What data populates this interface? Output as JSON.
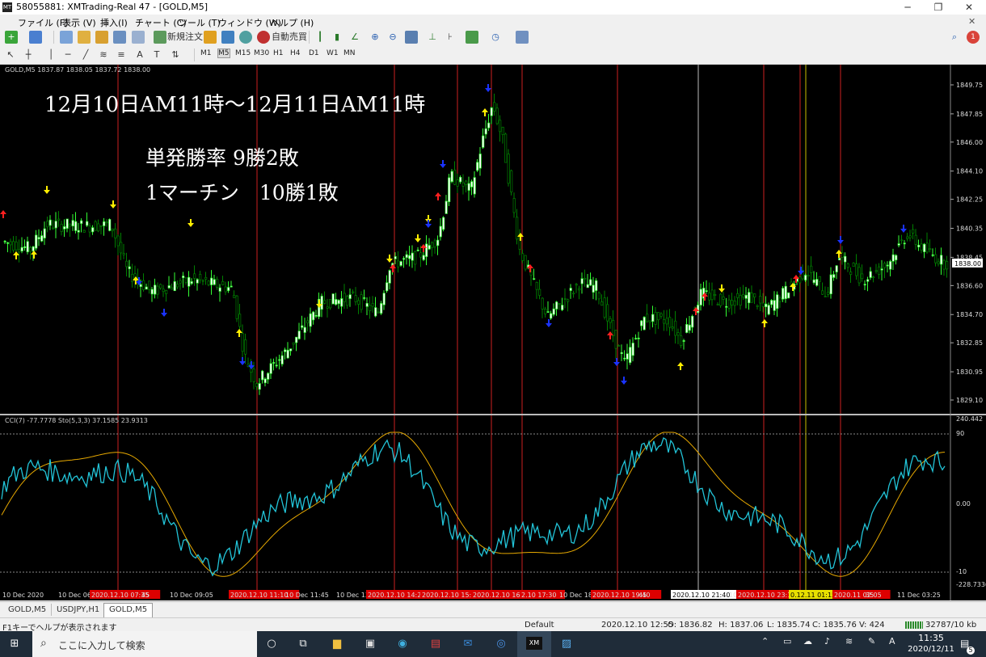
{
  "window": {
    "title": "58055881: XMTrading-Real 47 - [GOLD,M5]",
    "app_icon": "MT"
  },
  "menu": [
    "ファイル (F)",
    "表示 (V)",
    "挿入(I)",
    "チャート (C)",
    "ツール (T)",
    "ウィンドウ (W)",
    "ヘルプ (H)"
  ],
  "toolbar": {
    "new_order": "新規注文",
    "auto_trading": "自動売買",
    "notification_count": "1",
    "timeframes": [
      "M1",
      "M5",
      "M15",
      "M30",
      "H1",
      "H4",
      "D1",
      "W1",
      "MN"
    ],
    "active_timeframe": "M5"
  },
  "chart": {
    "info": "GOLD,M5 1837.87 1838.05 1837.72 1838.00",
    "annotation_title": "12月10日AM11時〜12月11日AM11時",
    "annotation_line1": "単発勝率 9勝2敗",
    "annotation_line2": "1マーチン　10勝1敗",
    "price_labels": [
      "1849.75",
      "1847.85",
      "1846.00",
      "1844.10",
      "1842.25",
      "1840.35",
      "1838.45",
      "1836.60",
      "1834.70",
      "1832.85",
      "1830.95",
      "1829.10"
    ],
    "current_price": "1838.00",
    "indicator_info": "CCI(7) -77.7778  Sto(5,3,3) 37.1585 23.9313",
    "indicator_labels": [
      "240.442",
      "90",
      "0.00",
      "-10",
      "-228.7336"
    ],
    "time_labels": [
      "10 Dec 2020",
      "10 Dec 06:25",
      "2020.12.10 07:35",
      "45",
      "10 Dec 09:05",
      "2020.12.10 11:10",
      "10 Dec 11:45",
      "10 Dec 13:",
      "2020.12.10 14:25",
      "2020.12.10 15:40",
      "2020.12.10 16:45",
      "2.10 17:30",
      "10 Dec 18:",
      "2020.12.10 19:40",
      "45",
      "2020.12.10 21:40",
      "10",
      "2020.12.10 23:1",
      "0.12.11 01:15",
      "2020.11 02:05",
      "35",
      "11 Dec 03:25"
    ],
    "colors": {
      "bull": "#33ff33",
      "bear": "#008000",
      "cci": "#22c4d8",
      "stoch": "#e6a800",
      "vline_red": "#cc2020"
    }
  },
  "tabs": [
    "GOLD,M5",
    "USDJPY,H1",
    "GOLD,M5"
  ],
  "status": {
    "help": "F1キーでヘルプが表示されます",
    "profile": "Default",
    "time": "2020.12.10 12:55",
    "open": "O: 1836.82",
    "high": "H: 1837.06",
    "low": "L: 1835.74",
    "close": "C: 1835.76",
    "volume": "V: 424",
    "traffic": "32787/10 kb"
  },
  "taskbar": {
    "search_placeholder": "ここに入力して検索",
    "clock_time": "11:35",
    "clock_date": "2020/12/11",
    "notification_badge": "5"
  }
}
